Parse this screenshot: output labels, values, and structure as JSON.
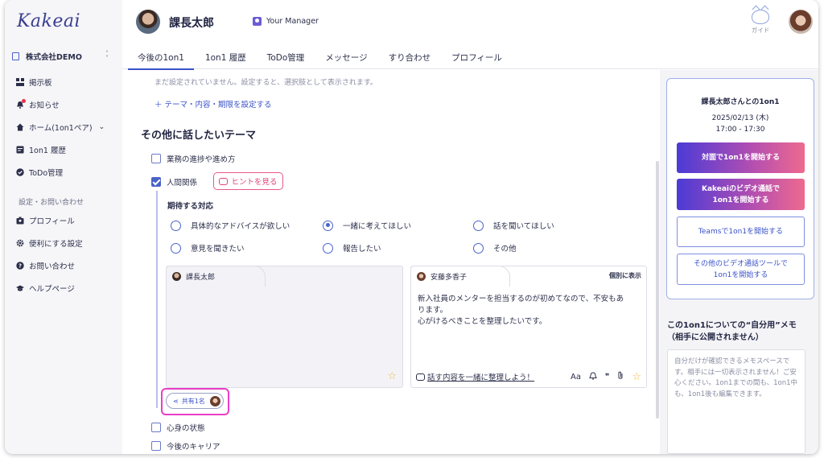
{
  "app": {
    "logo": "Kakeai"
  },
  "sidebar": {
    "company": "株式会社DEMO",
    "items": [
      {
        "label": "掲示板"
      },
      {
        "label": "お知らせ"
      },
      {
        "label": "ホーム(1on1ペア)"
      },
      {
        "label": "1on1 履歴"
      },
      {
        "label": "ToDo管理"
      }
    ],
    "section_label": "設定・お問い合わせ",
    "settings": [
      {
        "label": "プロフィール"
      },
      {
        "label": "便利にする設定"
      },
      {
        "label": "お問い合わせ"
      },
      {
        "label": "ヘルプページ"
      }
    ]
  },
  "header": {
    "name": "課長太郎",
    "role_badge": "Your Manager",
    "guide_label": "ガイド",
    "tabs": [
      {
        "label": "今後の1on1",
        "active": true
      },
      {
        "label": "1on1 履歴"
      },
      {
        "label": "ToDo管理"
      },
      {
        "label": "メッセージ"
      },
      {
        "label": "すり合わせ"
      },
      {
        "label": "プロフィール"
      }
    ]
  },
  "main": {
    "note": "まだ設定されていません。設定すると、選択肢として表示されます。",
    "set_theme_link": "＋  テーマ・内容・期限を設定する",
    "other_topics_title": "その他に話したいテーマ",
    "topics": [
      {
        "label": "業務の進捗や進め方",
        "checked": false
      },
      {
        "label": "人間関係",
        "checked": true
      },
      {
        "label": "心身の状態",
        "checked": false
      },
      {
        "label": "今後のキャリア",
        "checked": false
      }
    ],
    "hint_button": "ヒントを見る",
    "expectation_title": "期待する対応",
    "expectations": [
      {
        "label": "具体的なアドバイスが欲しい",
        "selected": false
      },
      {
        "label": "一緒に考えてほしい",
        "selected": true
      },
      {
        "label": "話を聞いてほしい",
        "selected": false
      },
      {
        "label": "意見を聞きたい",
        "selected": false
      },
      {
        "label": "報告したい",
        "selected": false
      },
      {
        "label": "その他",
        "selected": false
      }
    ],
    "manager_card": {
      "name": "課長太郎"
    },
    "member_card": {
      "name": "安藤多香子",
      "show_each": "個別に表示",
      "text_line1": "新入社員のメンターを担当するのが初めてなので、不安もあ",
      "text_line2": "ります。",
      "text_line3": "心がけるべきことを整理したいです。",
      "help_link": "話す内容を一緒に整理しよう！",
      "tool_font": "Aa",
      "tool_quote": "❞"
    },
    "share_pill": "共有1名"
  },
  "right_panel": {
    "title": "課長太郎さんとの1on1",
    "date": "2025/02/13 (木)",
    "time": "17:00 - 17:30",
    "btn_face": "対面で1on1を開始する",
    "btn_video_l1": "Kakeaiのビデオ通話で",
    "btn_video_l2": "1on1を開始する",
    "btn_teams": "Teamsで1on1を開始する",
    "btn_other_l1": "その他のビデオ通話ツールで",
    "btn_other_l2": "1on1を開始する",
    "memo_title_l1": "この1on1についての“自分用”メモ",
    "memo_title_l2": "（相手に公開されません）",
    "memo_placeholder": "自分だけが確認できるメモスペースです。相手には一切表示されません！ご安心ください。1on1までの間も、1on1中も、1on1後も編集できます。"
  },
  "colors": {
    "accent": "#3a52c7",
    "highlight": "#ea3ec6",
    "hint": "#e04677",
    "star": "#f0b840"
  }
}
